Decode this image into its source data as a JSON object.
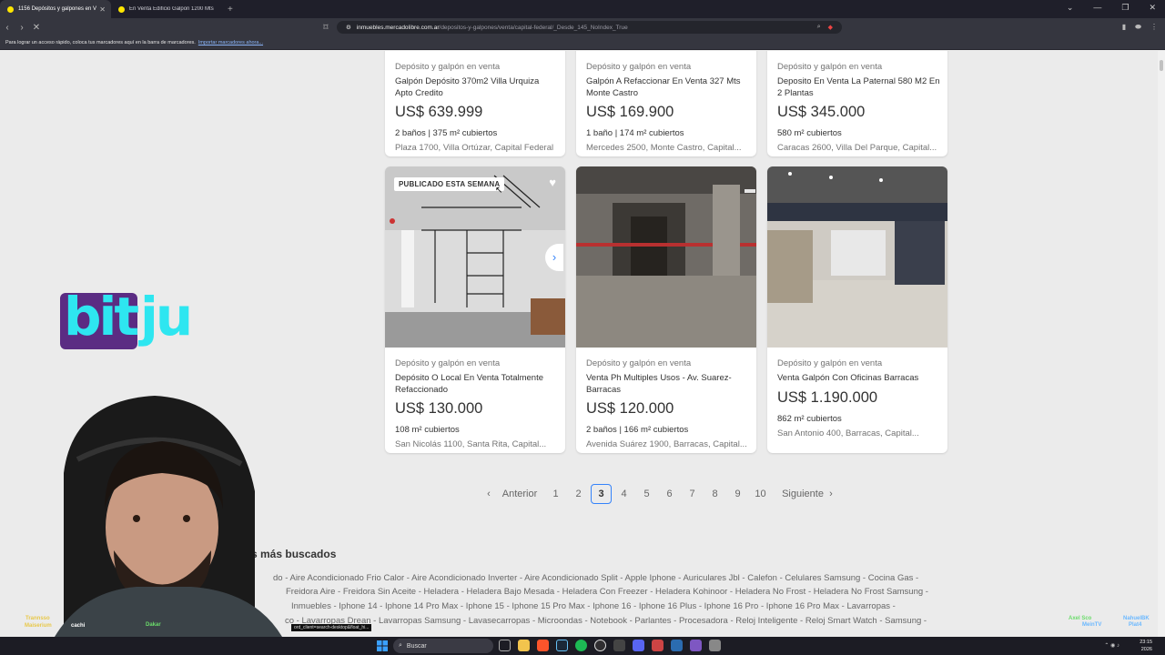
{
  "browser": {
    "tabs": [
      {
        "label": "1156 Depósitos y galpones en V",
        "active": true
      },
      {
        "label": "En Venta Edificio Galpon 1200 Mts M",
        "active": false
      }
    ],
    "url_host": "inmuebles.mercadolibre.com.ar",
    "url_path": "/depositos-y-galpones/venta/capital-federal/_Desde_145_NoIndex_True",
    "bookmarks_hint": "Para lograr un acceso rápido, coloca tus marcadores aquí en la barra de marcadores.",
    "bookmarks_link": "Importar marcadores ahora..."
  },
  "listings_top": [
    {
      "category": "Depósito y galpón en venta",
      "title": "Galpón Depósito 370m2 Villa Urquiza Apto Credito",
      "price": "US$ 639.999",
      "attrs": "2 baños | 375 m² cubiertos",
      "location": "Plaza 1700, Villa Ortúzar, Capital Federal"
    },
    {
      "category": "Depósito y galpón en venta",
      "title": "Galpón A Refaccionar En Venta 327 Mts Monte Castro",
      "price": "US$ 169.900",
      "attrs": "1 baño | 174 m² cubiertos",
      "location": "Mercedes 2500, Monte Castro, Capital..."
    },
    {
      "category": "Depósito y galpón en venta",
      "title": "Deposito En Venta La Paternal 580 M2 En 2 Plantas",
      "price": "US$ 345.000",
      "attrs": "580 m² cubiertos",
      "location": "Caracas 2600, Villa Del Parque, Capital..."
    }
  ],
  "listings_bottom": [
    {
      "badge": "PUBLICADO ESTA SEMANA",
      "category": "Depósito y galpón en venta",
      "title": "Depósito O Local En Venta Totalmente Refaccionado",
      "price": "US$ 130.000",
      "attrs": "108 m² cubiertos",
      "location": "San Nicolás 1100, Santa Rita, Capital..."
    },
    {
      "category": "Depósito y galpón en venta",
      "title": "Venta Ph Multiples Usos - Av. Suarez- Barracas",
      "price": "US$ 120.000",
      "attrs": "2 baños | 166 m² cubiertos",
      "location": "Avenida Suárez 1900, Barracas, Capital..."
    },
    {
      "category": "Depósito y galpón en venta",
      "title": "Venta Galpón Con Oficinas Barracas",
      "price": "US$ 1.190.000",
      "attrs": "862 m² cubiertos",
      "location": "San Antonio 400, Barracas, Capital..."
    }
  ],
  "pagination": {
    "prev": "Anterior",
    "next": "Siguiente",
    "pages": [
      "1",
      "2",
      "3",
      "4",
      "5",
      "6",
      "7",
      "8",
      "9",
      "10"
    ],
    "current": "3"
  },
  "searches": {
    "title": "s más buscados",
    "line1": "do - Aire Acondicionado Frio Calor - Aire Acondicionado Inverter - Aire Acondicionado Split - Apple Iphone - Auriculares Jbl - Calefon - Celulares Samsung - Cocina Gas -",
    "line2": "Freidora Aire - Freidora Sin Aceite - Heladera - Heladera Bajo Mesada - Heladera Con Freezer - Heladera Kohinoor - Heladera No Frost - Heladera No Frost Samsung -",
    "line3": "Inmuebles - Iphone 14 - Iphone 14 Pro Max - Iphone 15 - Iphone 15 Pro Max - Iphone 16 - Iphone 16 Plus - Iphone 16 Pro - Iphone 16 Pro Max - Lavarropas -",
    "line4": "co - Lavarropas Drean - Lavarropas Samsung - Lavasecarropas - Microondas - Notebook - Parlantes - Procesadora - Reloj Inteligente - Reloj Smart Watch - Samsung -"
  },
  "overlay": {
    "logo_left": "bit",
    "logo_right": "ju",
    "tooltip": "ord_client=search-desktop&float_hi...",
    "stream_names": [
      "Trannsso",
      "Maiserium",
      "cachi",
      "Dakar",
      "Axel Sco",
      "MeinTV",
      "NahuelBK",
      "Plat4"
    ]
  },
  "taskbar": {
    "search_placeholder": "Buscar",
    "time": "23:15",
    "date": "2026"
  },
  "colors": {
    "accent": "#3483fa",
    "brand_yellow": "#ffe600",
    "logo_purple": "#5b2c83",
    "logo_cyan": "#2ee6f0"
  }
}
